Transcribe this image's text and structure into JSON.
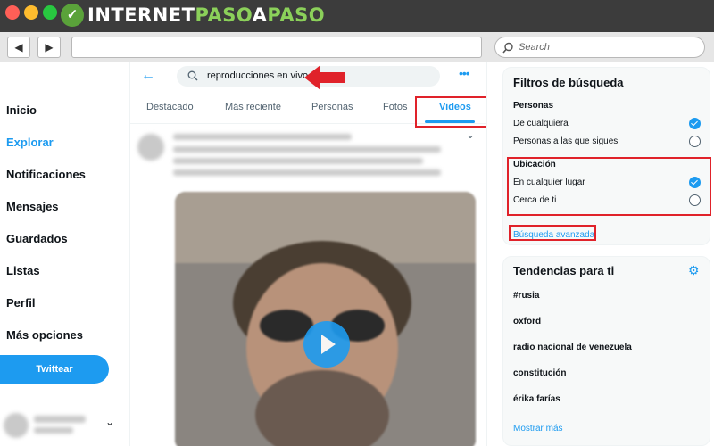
{
  "browser": {
    "logo_text_1": "INTERNET",
    "logo_text_2": "PASO",
    "logo_text_3": "A",
    "logo_text_4": "PASO",
    "search_placeholder": "Search"
  },
  "leftnav": {
    "items": [
      "Inicio",
      "Explorar",
      "Notificaciones",
      "Mensajes",
      "Guardados",
      "Listas",
      "Perfil",
      "Más opciones"
    ],
    "tweet_button": "Twittear"
  },
  "search": {
    "query": "reproducciones en vivo"
  },
  "tabs": [
    "Destacado",
    "Más reciente",
    "Personas",
    "Fotos",
    "Videos"
  ],
  "filters": {
    "title": "Filtros de búsqueda",
    "people_heading": "Personas",
    "people_options": [
      "De cualquiera",
      "Personas a las que sigues"
    ],
    "location_heading": "Ubicación",
    "location_options": [
      "En cualquier lugar",
      "Cerca de ti"
    ],
    "advanced_link": "Búsqueda avanzada"
  },
  "trends": {
    "title": "Tendencias para ti",
    "items": [
      "#rusia",
      "oxford",
      "radio nacional de venezuela",
      "constitución",
      "érika farías"
    ],
    "more": "Mostrar más"
  },
  "colors": {
    "accent": "#1d9bf0",
    "highlight": "#e0222a"
  }
}
